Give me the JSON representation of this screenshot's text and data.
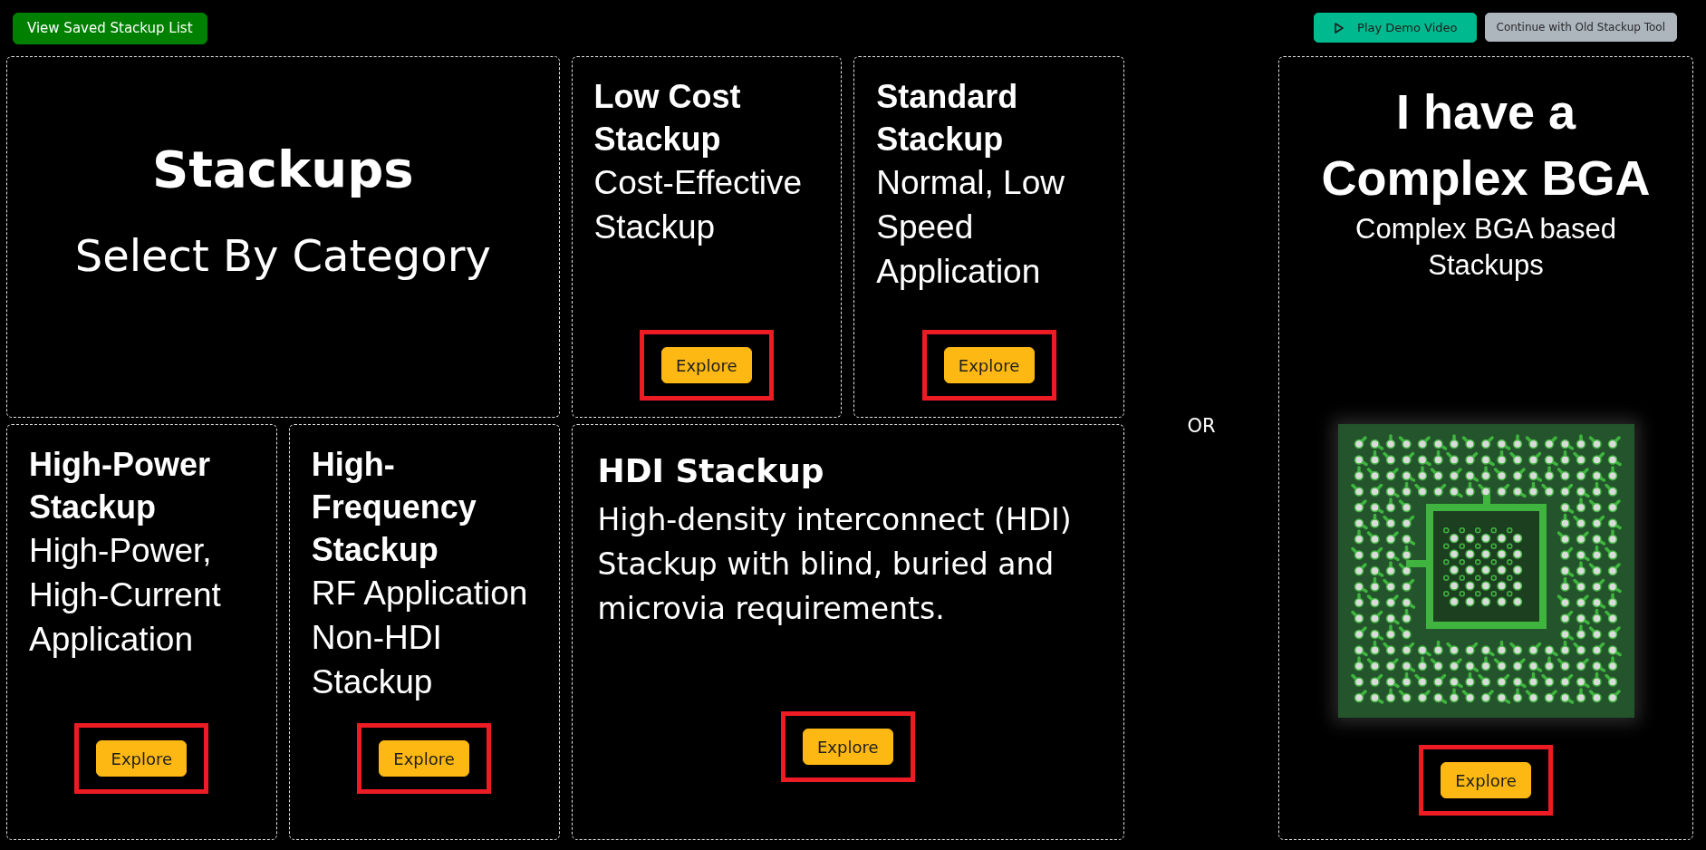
{
  "toolbar": {
    "saved_list_button": "View Saved Stackup List",
    "demo_button": "Play Demo Video",
    "old_tool_button": "Continue with Old Stackup Tool"
  },
  "intro": {
    "title": "Stackups",
    "subtitle": "Select By Category"
  },
  "categories": [
    {
      "kind": "tile",
      "title": "Low Cost Stackup",
      "description": "Cost-Effective Stackup",
      "button": "Explore",
      "highlighted": true
    },
    {
      "kind": "tile",
      "title": "Standard Stackup",
      "description": "Normal, Low Speed Application",
      "button": "Explore",
      "highlighted": true
    },
    {
      "kind": "tile",
      "title": "High-Power Stackup",
      "description": "High-Power, High-Current Application",
      "button": "Explore",
      "highlighted": true
    },
    {
      "kind": "tile",
      "title": "High-Frequency Stackup",
      "description": "RF Application Non-HDI Stackup",
      "button": "Explore",
      "highlighted": true
    },
    {
      "kind": "wide",
      "title": "HDI Stackup",
      "description": "High-density interconnect (HDI) Stackup with blind, buried and microvia requirements.",
      "button": "Explore",
      "highlighted": true
    }
  ],
  "separator": "OR",
  "bga_card": {
    "title": "I have a Complex BGA",
    "subtitle": "Complex BGA based Stackups",
    "button": "Explore",
    "highlighted": true
  }
}
